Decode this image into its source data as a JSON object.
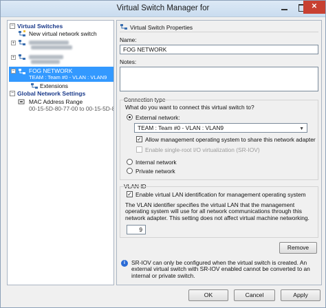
{
  "window": {
    "title": "Virtual Switch Manager for"
  },
  "tree": {
    "virtual_switches_header": "Virtual Switches",
    "new_switch": "New virtual network switch",
    "selected_switch": "FOG NETWORK",
    "selected_switch_sub": "TEAM : Team #0 - VLAN : VLAN9",
    "extensions": "Extensions",
    "global_header": "Global Network Settings",
    "mac_range": "MAC Address Range",
    "mac_range_value": "00-15-5D-80-77-00 to 00-15-5D-8..."
  },
  "properties": {
    "header": "Virtual Switch Properties",
    "name_label": "Name:",
    "name_value": "FOG NETWORK",
    "notes_label": "Notes:",
    "connection_type_label": "Connection type",
    "connection_question": "What do you want to connect this virtual switch to?",
    "external_label": "External network:",
    "external_adapter": "TEAM : Team #0 - VLAN : VLAN9",
    "allow_mgmt_label": "Allow management operating system to share this network adapter",
    "sriov_label": "Enable single-root I/O virtualization (SR-IOV)",
    "internal_label": "Internal network",
    "private_label": "Private network",
    "vlan_header": "VLAN ID",
    "vlan_enable_label": "Enable virtual LAN identification for management operating system",
    "vlan_desc": "The VLAN identifier specifies the virtual LAN that the management operating system will use for all network communications through this network adapter. This setting does not affect virtual machine networking.",
    "vlan_value": "9",
    "remove_button": "Remove",
    "sriov_info": "SR-IOV can only be configured when the virtual switch is created. An external virtual switch with SR-IOV enabled cannot be converted to an internal or private switch."
  },
  "footer": {
    "ok": "OK",
    "cancel": "Cancel",
    "apply": "Apply"
  },
  "icons": {
    "minimize": "minimize-icon",
    "maximize": "maximize-icon",
    "close": "close-icon",
    "switch": "network-switch-icon",
    "info": "info-icon"
  },
  "colors": {
    "selection": "#3399ff",
    "close_button": "#c84031",
    "section_header": "#1a3a8a"
  }
}
